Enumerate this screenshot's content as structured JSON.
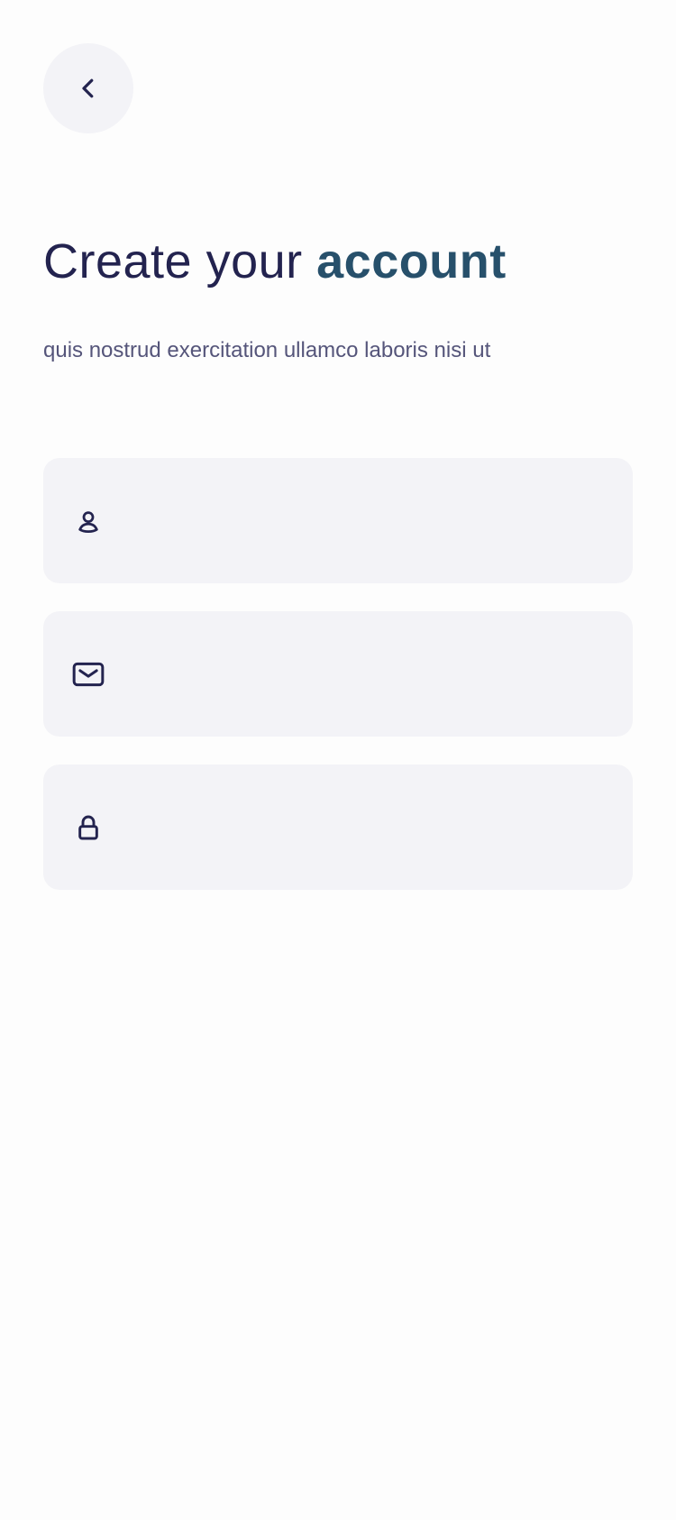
{
  "header": {
    "back_icon": "chevron-left-icon"
  },
  "title": {
    "prefix": "Create your ",
    "accent": "account"
  },
  "subtitle": "quis nostrud exercitation ullamco laboris nisi ut",
  "form": {
    "name_field": {
      "icon": "user-icon",
      "value": "",
      "placeholder": ""
    },
    "email_field": {
      "icon": "mail-icon",
      "value": "",
      "placeholder": ""
    },
    "password_field": {
      "icon": "lock-icon",
      "value": "",
      "placeholder": ""
    }
  },
  "colors": {
    "background": "#fdfdfd",
    "title_text": "#23234f",
    "accent_text": "#27506b",
    "subtitle_text": "#55557a",
    "field_background": "#f3f3f7",
    "icon": "#23234f"
  }
}
